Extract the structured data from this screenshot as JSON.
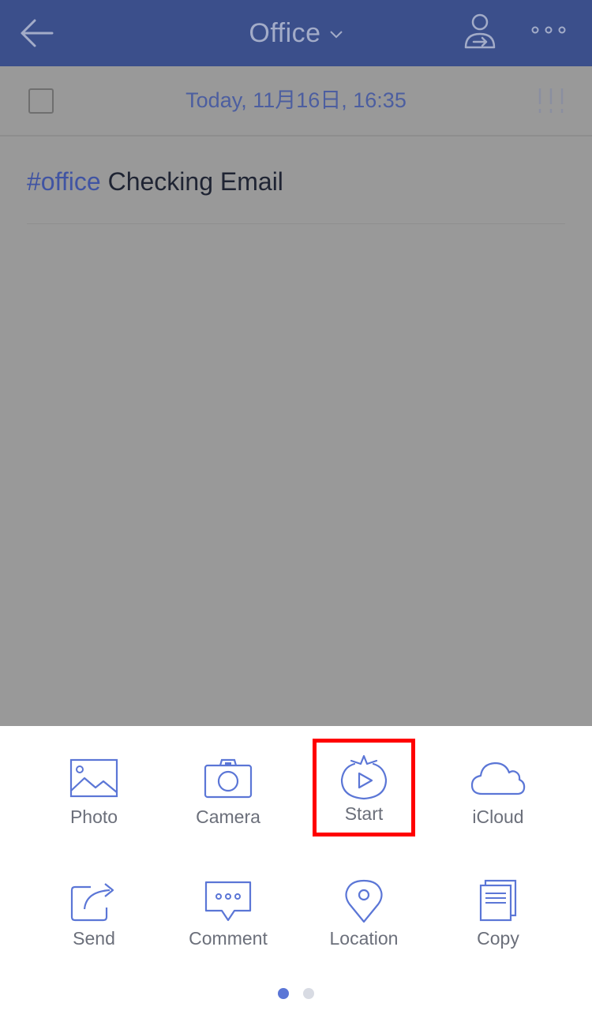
{
  "nav": {
    "title": "Office",
    "back_icon": "arrow-left-icon",
    "chevron_icon": "chevron-down-icon",
    "share_icon": "person-share-icon",
    "more_icon": "more-dots-icon"
  },
  "task": {
    "date": "Today, 11月16日, 16:35",
    "tag": "#office",
    "title": "Checking Email",
    "checkbox_checked": false,
    "priority_icon": "priority-marks-icon"
  },
  "actions": [
    {
      "label": "Photo",
      "icon": "photo-icon"
    },
    {
      "label": "Camera",
      "icon": "camera-icon"
    },
    {
      "label": "Start",
      "icon": "pomodoro-start-icon"
    },
    {
      "label": "iCloud",
      "icon": "cloud-icon"
    },
    {
      "label": "Send",
      "icon": "share-arrow-icon"
    },
    {
      "label": "Comment",
      "icon": "comment-icon"
    },
    {
      "label": "Location",
      "icon": "location-pin-icon"
    },
    {
      "label": "Copy",
      "icon": "copy-icon"
    }
  ],
  "pager": {
    "pages": 2,
    "current": 1
  },
  "colors": {
    "nav_bar": "#3b4f8b",
    "overlay_gray": "#999999",
    "accent_blue": "#5b76d6",
    "highlight_red": "#ff0000",
    "label_gray": "#6b6f7a"
  }
}
